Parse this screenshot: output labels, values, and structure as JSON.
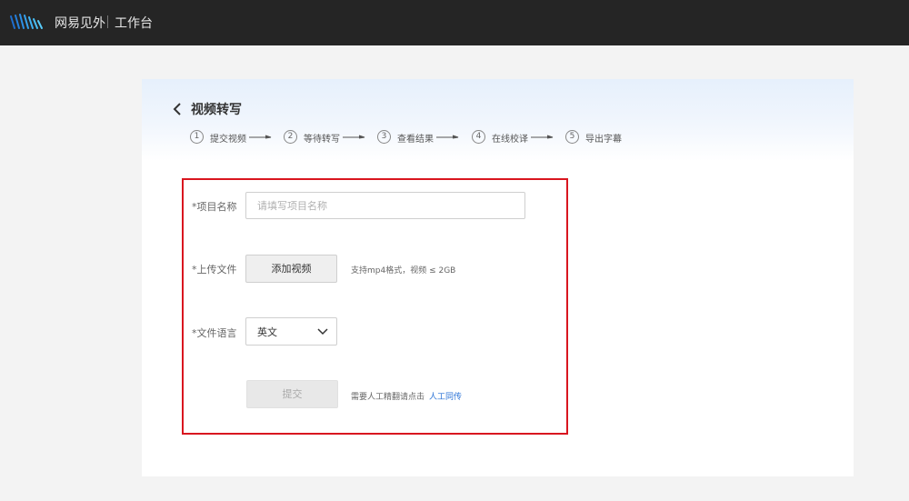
{
  "topbar": {
    "brand_name": "网易见外",
    "brand_sub": "工作台"
  },
  "page": {
    "title": "视频转写",
    "steps": [
      {
        "num": "1",
        "label": "提交视频"
      },
      {
        "num": "2",
        "label": "等待转写"
      },
      {
        "num": "3",
        "label": "查看结果"
      },
      {
        "num": "4",
        "label": "在线校译"
      },
      {
        "num": "5",
        "label": "导出字幕"
      }
    ]
  },
  "form": {
    "project_name_label": "*项目名称",
    "project_name_placeholder": "请填写项目名称",
    "project_name_value": "",
    "upload_label": "*上传文件",
    "add_video_label": "添加视频",
    "upload_hint": "支持mp4格式，视频 ≤ 2GB",
    "language_label": "*文件语言",
    "language_value": "英文",
    "submit_label": "提交",
    "human_hint": "需要人工精翻请点击",
    "human_link": "人工同传"
  },
  "colors": {
    "topbar": "#252525",
    "highlight_border": "#d9161f",
    "link": "#2a72d6"
  },
  "icons": {
    "logo": "wave-logo-icon",
    "back": "chevron-left-icon",
    "select": "chevron-down-icon",
    "arrow": "arrow-right-icon"
  }
}
